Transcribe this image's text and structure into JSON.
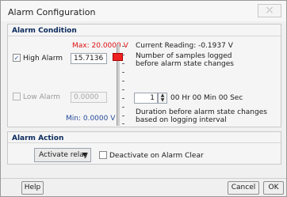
{
  "window": {
    "title": "Alarm Configuration",
    "close_symbol": "⤫"
  },
  "alarm_condition": {
    "title": "Alarm Condition",
    "max_label": "Max: 20.0000 V",
    "min_label": "Min: 0.0000 V",
    "high_alarm": {
      "checked": true,
      "label": "High Alarm",
      "value": "15.7136"
    },
    "low_alarm": {
      "checked": false,
      "label": "Low Alarm",
      "value": "0.0000"
    },
    "current_reading": "Current Reading: -0.1937 V",
    "samples_text_line1": "Number of samples logged",
    "samples_text_line2": "before alarm state changes",
    "samples_value": "1",
    "duration_value": "00 Hr 00 Min 00 Sec",
    "duration_text_line1": "Duration before alarm state changes",
    "duration_text_line2": "based on logging interval",
    "slider_level": 0.21
  },
  "alarm_action": {
    "title": "Alarm Action",
    "action_selected": "Activate relay",
    "deactivate_label": "Deactivate on Alarm Clear",
    "deactivate_checked": false
  },
  "footer": {
    "help": "Help",
    "cancel": "Cancel",
    "ok": "OK"
  },
  "icons": {
    "checkmark": "✓",
    "spin_up": "▲",
    "spin_down": "▼",
    "dropdown": "▼"
  }
}
